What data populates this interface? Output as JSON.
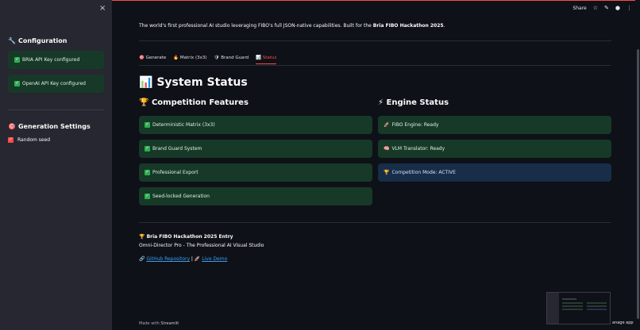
{
  "sidebar": {
    "close_icon": "×",
    "configuration": {
      "icon": "🔧",
      "title": "Configuration"
    },
    "alerts": [
      {
        "text": "BRIA API Key configured"
      },
      {
        "text": "OpenAI API Key configured"
      }
    ],
    "generation": {
      "icon": "🎯",
      "title": "Generation Settings"
    },
    "random_seed_label": "Random seed"
  },
  "toolbar": {
    "share_label": "Share",
    "star_icon": "☆",
    "edit_icon": "✎",
    "github_icon": "●",
    "menu_icon": "⋮"
  },
  "intro": {
    "text_before": "The world's first professional AI studio leveraging FIBO's full JSON-native capabilities. Built for the ",
    "bold": "Bria FIBO Hackathon 2025",
    "text_after": "."
  },
  "tabs": [
    {
      "icon": "🎯",
      "label": "Generate"
    },
    {
      "icon": "🔥",
      "label": "Matrix (3x3)"
    },
    {
      "icon": "🛡",
      "label": "Brand Guard"
    },
    {
      "icon": "📊",
      "label": "Status"
    }
  ],
  "status": {
    "heading_icon": "📊",
    "heading": "System Status",
    "features": {
      "icon": "🏆",
      "title": "Competition Features",
      "items": [
        "Deterministic Matrix (3x3)",
        "Brand Guard System",
        "Professional Export",
        "Seed-locked Generation"
      ]
    },
    "engine": {
      "icon": "⚡",
      "title": "Engine Status",
      "items": [
        {
          "icon": "🚀",
          "text": "FIBO Engine: Ready"
        },
        {
          "icon": "🧠",
          "text": "VLM Translator: Ready"
        },
        {
          "icon": "🏆",
          "text": "Competition Mode: ACTIVE"
        }
      ]
    }
  },
  "footer": {
    "title_icon": "🏆",
    "title": "Bria FIBO Hackathon 2025 Entry",
    "subtitle": "Omni-Director Pro - The Professional AI Visual Studio",
    "link_icon": "🔗",
    "repo_link": "GitHub Repository",
    "separator": " | ",
    "demo_icon": "🚀",
    "demo_link": "Live Demo"
  },
  "made_with": {
    "prefix": "Made with ",
    "brand": "Streamlit"
  },
  "manage_app": "anage app",
  "colors": {
    "accent": "#ff4b4b",
    "success_bg": "#173928",
    "info_bg": "#172d48",
    "link": "#3d9df0"
  }
}
